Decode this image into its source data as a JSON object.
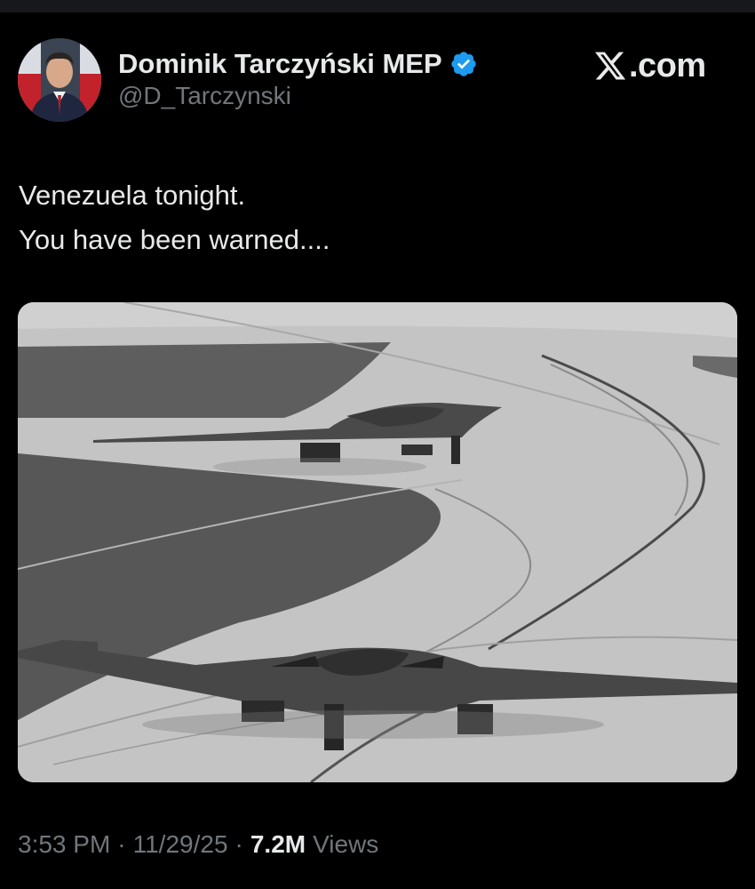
{
  "author": {
    "name": "Dominik Tarczyński MEP",
    "handle": "@D_Tarczynski",
    "verified": true
  },
  "brand": {
    "text": ".com",
    "icon": "x-logo-icon"
  },
  "tweet": {
    "lines": [
      "Venezuela tonight.",
      "You have been warned...."
    ]
  },
  "media": {
    "description_icon": "photo"
  },
  "meta": {
    "time": "3:53 PM",
    "separator": "·",
    "date": "11/29/25",
    "views_count": "7.2M",
    "views_label": "Views"
  },
  "colors": {
    "background": "#000000",
    "text_primary": "#e7e9ea",
    "text_secondary": "#71767b",
    "verified_blue": "#1d9bf0"
  }
}
